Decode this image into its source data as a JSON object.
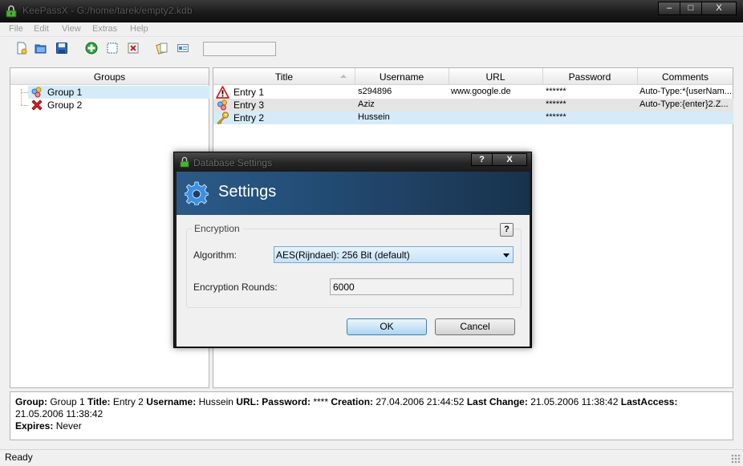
{
  "window": {
    "title": "KeePassX - G:/home/tarek/empty2.kdb",
    "controls": [
      "–",
      "□",
      "X"
    ]
  },
  "menu": [
    "File",
    "Edit",
    "View",
    "Extras",
    "Help"
  ],
  "groups_pane": {
    "header": "Groups",
    "items": [
      {
        "label": "Group 1",
        "icon": "group-people-icon",
        "selected": true
      },
      {
        "label": "Group 2",
        "icon": "red-x-icon",
        "selected": false
      }
    ]
  },
  "entries_pane": {
    "columns": [
      "Title",
      "Username",
      "URL",
      "Password",
      "Comments"
    ],
    "rows": [
      {
        "title": "Entry 1",
        "icon": "warning-icon",
        "username": "s294896",
        "url": "www.google.de",
        "password": "******",
        "comments": "Auto-Type:*{userNam..."
      },
      {
        "title": "Entry 3",
        "icon": "group-people-icon",
        "username": "Aziz",
        "url": "",
        "password": "******",
        "comments": "Auto-Type:{enter}2.Z..."
      },
      {
        "title": "Entry 2",
        "icon": "key-icon",
        "username": "Hussein",
        "url": "",
        "password": "******",
        "comments": ""
      }
    ]
  },
  "details": {
    "group_label": "Group:",
    "group": "Group 1",
    "title_label": "Title:",
    "title": "Entry 2",
    "username_label": "Username:",
    "username": "Hussein",
    "url_label": "URL:",
    "url": "",
    "password_label": "Password:",
    "password": "****",
    "creation_label": "Creation:",
    "creation": "27.04.2006 21:44:52",
    "lastchange_label": "Last Change:",
    "lastchange": "21.05.2006 11:38:42",
    "lastaccess_label": "LastAccess:",
    "lastaccess": "21.05.2006 11:38:42",
    "expires_label": "Expires:",
    "expires": "Never"
  },
  "status": {
    "text": "Ready"
  },
  "dialog": {
    "title": "Database Settings",
    "help_button": "?",
    "close_button": "X",
    "banner_title": "Settings",
    "groupbox_label": "Encryption",
    "groupbox_help": "?",
    "algorithm_label": "Algorithm:",
    "algorithm_value": "AES(Rijndael):  256 Bit   (default)",
    "rounds_label": "Encryption Rounds:",
    "rounds_value": "6000",
    "ok_label": "OK",
    "cancel_label": "Cancel"
  },
  "colors": {
    "selection": "#d6ebf8",
    "banner": "#24507b",
    "titlebar": "#1c1c1c"
  }
}
